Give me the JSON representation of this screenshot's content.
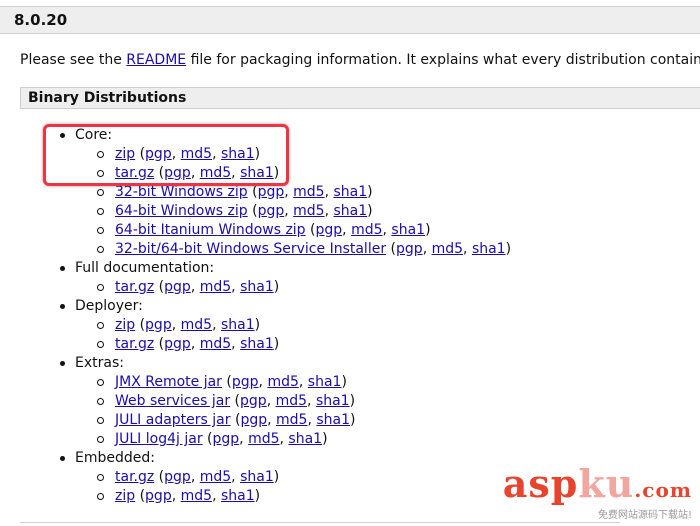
{
  "version": "8.0.20",
  "intro": {
    "prefix": "Please see the ",
    "link": "README",
    "suffix": " file for packaging information. It explains what every distribution contains."
  },
  "section_title": "Binary Distributions",
  "groups": {
    "core": {
      "label": "Core:",
      "items": [
        {
          "name": "zip",
          "pgp": "pgp",
          "md5": "md5",
          "sha1": "sha1"
        },
        {
          "name": "tar.gz",
          "pgp": "pgp",
          "md5": "md5",
          "sha1": "sha1"
        },
        {
          "name": "32-bit Windows zip",
          "pgp": "pgp",
          "md5": "md5",
          "sha1": "sha1"
        },
        {
          "name": "64-bit Windows zip",
          "pgp": "pgp",
          "md5": "md5",
          "sha1": "sha1"
        },
        {
          "name": "64-bit Itanium Windows zip",
          "pgp": "pgp",
          "md5": "md5",
          "sha1": "sha1"
        },
        {
          "name": "32-bit/64-bit Windows Service Installer",
          "pgp": "pgp",
          "md5": "md5",
          "sha1": "sha1"
        }
      ]
    },
    "fulldoc": {
      "label": "Full documentation:",
      "items": [
        {
          "name": "tar.gz",
          "pgp": "pgp",
          "md5": "md5",
          "sha1": "sha1"
        }
      ]
    },
    "deployer": {
      "label": "Deployer:",
      "items": [
        {
          "name": "zip",
          "pgp": "pgp",
          "md5": "md5",
          "sha1": "sha1"
        },
        {
          "name": "tar.gz",
          "pgp": "pgp",
          "md5": "md5",
          "sha1": "sha1"
        }
      ]
    },
    "extras": {
      "label": "Extras:",
      "items": [
        {
          "name": "JMX Remote jar",
          "pgp": "pgp",
          "md5": "md5",
          "sha1": "sha1"
        },
        {
          "name": "Web services jar",
          "pgp": "pgp",
          "md5": "md5",
          "sha1": "sha1"
        },
        {
          "name": "JULI adapters jar",
          "pgp": "pgp",
          "md5": "md5",
          "sha1": "sha1"
        },
        {
          "name": "JULI log4j jar",
          "pgp": "pgp",
          "md5": "md5",
          "sha1": "sha1"
        }
      ]
    },
    "embedded": {
      "label": "Embedded:",
      "items": [
        {
          "name": "tar.gz",
          "pgp": "pgp",
          "md5": "md5",
          "sha1": "sha1"
        },
        {
          "name": "zip",
          "pgp": "pgp",
          "md5": "md5",
          "sha1": "sha1"
        }
      ]
    }
  },
  "watermark": {
    "asp": "asp",
    "ku": "ku",
    "com": ".com",
    "tagline": "免费网站源码下载站!"
  },
  "colors": {
    "link": "#1a0dab",
    "highlight_box": "#ee3344",
    "header_bg": "#eeeeee"
  }
}
